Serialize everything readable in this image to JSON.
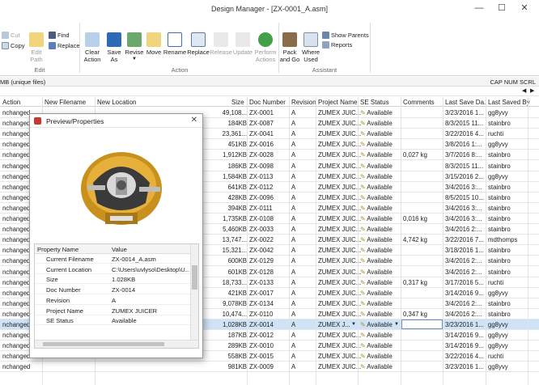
{
  "window": {
    "title": "Design Manager - [ZX-0001_A.asm]",
    "minimize": "—",
    "maximize": "☐",
    "close": "✕"
  },
  "ribbon": {
    "cut": "Cut",
    "copy": "Copy",
    "find": "Find",
    "replace_small": "Replace",
    "edit_path": "Edit\nPath",
    "clear_action": "Clear\nAction",
    "save_as": "Save\nAs",
    "revise": "Revise",
    "move": "Move",
    "rename": "Rename",
    "replace": "Replace",
    "release": "Release",
    "update": "Update",
    "perform_actions": "Perform\nActions",
    "pack_and_go": "Pack\nand Go",
    "where_used": "Where\nUsed",
    "show_parents": "Show Parents",
    "reports": "Reports",
    "group_edit": "Edit",
    "group_action": "Action",
    "group_assistant": "Assistant"
  },
  "status": {
    "left": "MB (unique files)",
    "right": "CAP NUM SCRL"
  },
  "columns": [
    "Action",
    "New Filename",
    "New Location",
    "Size",
    "Doc Number",
    "Revision",
    "Project Name",
    "SE Status",
    "Comments",
    "Last Save Da...",
    "Last Saved By"
  ],
  "rows": [
    {
      "action": "nchanged",
      "size": "49,108...",
      "doc": "ZX-0001",
      "rev": "A",
      "proj": "ZUMEX JUIC...",
      "status": "Available",
      "comments": "",
      "date": "3/23/2016 1...",
      "by": "gg8yvy"
    },
    {
      "action": "nchanged",
      "size": "184KB",
      "doc": "ZX-0087",
      "rev": "A",
      "proj": "ZUMEX JUIC...",
      "status": "Available",
      "comments": "",
      "date": "8/3/2015 11...",
      "by": "stainbro"
    },
    {
      "action": "nchanged",
      "size": "23,361...",
      "doc": "ZX-0041",
      "rev": "A",
      "proj": "ZUMEX JUIC...",
      "status": "Available",
      "comments": "",
      "date": "3/22/2016 4...",
      "by": "ruchti"
    },
    {
      "action": "nchanged",
      "size": "451KB",
      "doc": "ZX-0016",
      "rev": "A",
      "proj": "ZUMEX JUIC...",
      "status": "Available",
      "comments": "",
      "date": "3/8/2016 1:...",
      "by": "gg8yvy"
    },
    {
      "action": "nchanged",
      "size": "1,912KB",
      "doc": "ZX-0028",
      "rev": "A",
      "proj": "ZUMEX JUIC...",
      "status": "Available",
      "comments": "0,027 kg",
      "date": "3/7/2016 8:...",
      "by": "stainbro"
    },
    {
      "action": "nchanged",
      "size": "186KB",
      "doc": "ZX-0098",
      "rev": "A",
      "proj": "ZUMEX JUIC...",
      "status": "Available",
      "comments": "",
      "date": "8/3/2015 11...",
      "by": "stainbro"
    },
    {
      "action": "nchanged",
      "size": "1,584KB",
      "doc": "ZX-0113",
      "rev": "A",
      "proj": "ZUMEX JUIC...",
      "status": "Available",
      "comments": "",
      "date": "3/15/2016 2...",
      "by": "gg8yvy"
    },
    {
      "action": "nchanged",
      "size": "641KB",
      "doc": "ZX-0112",
      "rev": "A",
      "proj": "ZUMEX JUIC...",
      "status": "Available",
      "comments": "",
      "date": "3/4/2016 3:...",
      "by": "stainbro"
    },
    {
      "action": "nchanged",
      "size": "428KB",
      "doc": "ZX-0096",
      "rev": "A",
      "proj": "ZUMEX JUIC...",
      "status": "Available",
      "comments": "",
      "date": "8/5/2015 10...",
      "by": "stainbro"
    },
    {
      "action": "nchanged",
      "size": "394KB",
      "doc": "ZX-0111",
      "rev": "A",
      "proj": "ZUMEX JUIC...",
      "status": "Available",
      "comments": "",
      "date": "3/4/2016 3:...",
      "by": "stainbro"
    },
    {
      "action": "nchanged",
      "size": "1,735KB",
      "doc": "ZX-0108",
      "rev": "A",
      "proj": "ZUMEX JUIC...",
      "status": "Available",
      "comments": "0,016 kg",
      "date": "3/4/2016 3:...",
      "by": "stainbro"
    },
    {
      "action": "nchanged",
      "size": "5,460KB",
      "doc": "ZX-0033",
      "rev": "A",
      "proj": "ZUMEX JUIC...",
      "status": "Available",
      "comments": "",
      "date": "3/4/2016 2:...",
      "by": "stainbro"
    },
    {
      "action": "nchanged",
      "size": "13,747...",
      "doc": "ZX-0022",
      "rev": "A",
      "proj": "ZUMEX JUIC...",
      "status": "Available",
      "comments": "4,742 kg",
      "date": "3/22/2016 7...",
      "by": "mdthomps"
    },
    {
      "action": "nchanged",
      "size": "15,321...",
      "doc": "ZX-0042",
      "rev": "A",
      "proj": "ZUMEX JUIC...",
      "status": "Available",
      "comments": "",
      "date": "3/18/2016 1...",
      "by": "stainbro"
    },
    {
      "action": "nchanged",
      "size": "600KB",
      "doc": "ZX-0129",
      "rev": "A",
      "proj": "ZUMEX JUIC...",
      "status": "Available",
      "comments": "",
      "date": "3/4/2016 2:...",
      "by": "stainbro"
    },
    {
      "action": "nchanged",
      "size": "601KB",
      "doc": "ZX-0128",
      "rev": "A",
      "proj": "ZUMEX JUIC...",
      "status": "Available",
      "comments": "",
      "date": "3/4/2016 2:...",
      "by": "stainbro"
    },
    {
      "action": "nchanged",
      "size": "18,733...",
      "doc": "ZX-0133",
      "rev": "A",
      "proj": "ZUMEX JUIC...",
      "status": "Available",
      "comments": "0,317 kg",
      "date": "3/17/2016 5...",
      "by": "ruchti"
    },
    {
      "action": "nchanged",
      "size": "421KB",
      "doc": "ZX-0017",
      "rev": "A",
      "proj": "ZUMEX JUIC...",
      "status": "Available",
      "comments": "",
      "date": "3/14/2016 9...",
      "by": "gg8yvy"
    },
    {
      "action": "nchanged",
      "size": "9,078KB",
      "doc": "ZX-0134",
      "rev": "A",
      "proj": "ZUMEX JUIC...",
      "status": "Available",
      "comments": "",
      "date": "3/4/2016 2:...",
      "by": "stainbro"
    },
    {
      "action": "nchanged",
      "size": "10,474...",
      "doc": "ZX-0110",
      "rev": "A",
      "proj": "ZUMEX JUIC...",
      "status": "Available",
      "comments": "0,347 kg",
      "date": "3/4/2016 2:...",
      "by": "stainbro"
    },
    {
      "action": "nchanged",
      "size": "1,028KB",
      "doc": "ZX-0014",
      "rev": "A",
      "proj": "ZUMEX J...",
      "status": "Available",
      "comments": "",
      "date": "3/23/2016 1...",
      "by": "gg8yvy"
    },
    {
      "action": "nchanged",
      "size": "187KB",
      "doc": "ZX-0012",
      "rev": "A",
      "proj": "ZUMEX JUIC...",
      "status": "Available",
      "comments": "",
      "date": "3/14/2016 9...",
      "by": "gg8yvy"
    },
    {
      "action": "nchanged",
      "size": "289KB",
      "doc": "ZX-0010",
      "rev": "A",
      "proj": "ZUMEX JUIC...",
      "status": "Available",
      "comments": "",
      "date": "3/14/2016 9...",
      "by": "gg8yvy"
    },
    {
      "action": "nchanged",
      "size": "558KB",
      "doc": "ZX-0015",
      "rev": "A",
      "proj": "ZUMEX JUIC...",
      "status": "Available",
      "comments": "",
      "date": "3/22/2016 4...",
      "by": "ruchti"
    },
    {
      "action": "nchanged",
      "size": "981KB",
      "doc": "ZX-0009",
      "rev": "A",
      "proj": "ZUMEX JUIC...",
      "status": "Available",
      "comments": "",
      "date": "3/23/2016 1...",
      "by": "gg8yvy"
    }
  ],
  "dialog": {
    "title": "Preview/Properties",
    "close": "✕",
    "header": {
      "property": "Property Name",
      "value": "Value"
    },
    "props": [
      {
        "name": "Current Filename",
        "value": "ZX-0014_A.asm"
      },
      {
        "name": "Current Location",
        "value": "C:\\Users\\uvlyso\\Desktop\\U..."
      },
      {
        "name": "Size",
        "value": "1.028KB"
      },
      {
        "name": "Doc Number",
        "value": "ZX-0014"
      },
      {
        "name": "Revision",
        "value": "A"
      },
      {
        "name": "Project Name",
        "value": "ZUMEX JUICER"
      },
      {
        "name": "SE Status",
        "value": "Available"
      }
    ]
  }
}
